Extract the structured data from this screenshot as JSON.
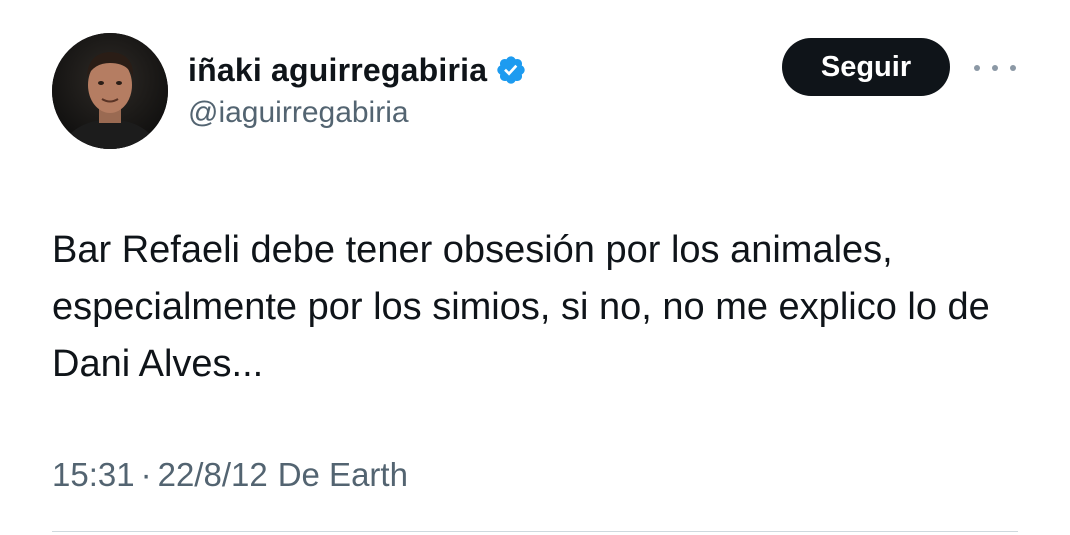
{
  "author": {
    "display_name": "iñaki aguirregabiria",
    "handle": "@iaguirregabiria",
    "verified": true,
    "verified_color": "#1d9bf0"
  },
  "actions": {
    "follow_label": "Seguir",
    "more_icon": "ellipsis-icon"
  },
  "tweet": {
    "text": "Bar Refaeli debe tener obsesión por los animales, especialmente por los simios, si no, no me explico lo de Dani Alves...",
    "time": "15:31",
    "separator": "·",
    "date": "22/8/12",
    "source": "De Earth"
  },
  "colors": {
    "text_primary": "#0f1419",
    "text_secondary": "#536471",
    "button_bg": "#0f1419",
    "divider": "#cfd9de"
  }
}
